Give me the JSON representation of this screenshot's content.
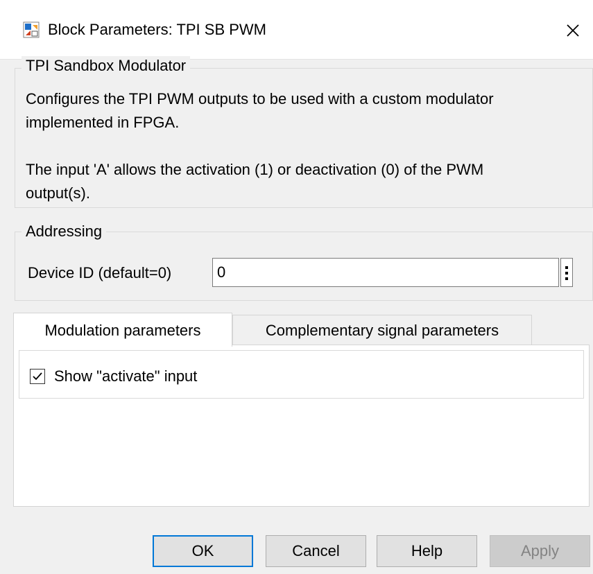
{
  "window": {
    "title": "Block Parameters: TPI SB PWM",
    "icon": "simulink-block-icon",
    "close_icon": "close-icon"
  },
  "description_group": {
    "legend": "TPI Sandbox Modulator",
    "line1": "Configures the TPI PWM outputs to be used with a custom modulator",
    "line2": "implemented in FPGA.",
    "line3": "The input 'A' allows the activation (1) or deactivation (0) of the PWM",
    "line4": "output(s)."
  },
  "addressing": {
    "legend": "Addressing",
    "device_id_label": "Device ID (default=0)",
    "device_id_value": "0"
  },
  "tabs": [
    {
      "label": "Modulation parameters",
      "active": true
    },
    {
      "label": "Complementary signal parameters",
      "active": false
    }
  ],
  "modulation": {
    "show_activate_label": "Show \"activate\" input",
    "show_activate_checked": true
  },
  "buttons": {
    "ok": "OK",
    "cancel": "Cancel",
    "help": "Help",
    "apply": "Apply"
  },
  "colors": {
    "default_button_border": "#0078d7",
    "disabled_text": "#838383"
  }
}
